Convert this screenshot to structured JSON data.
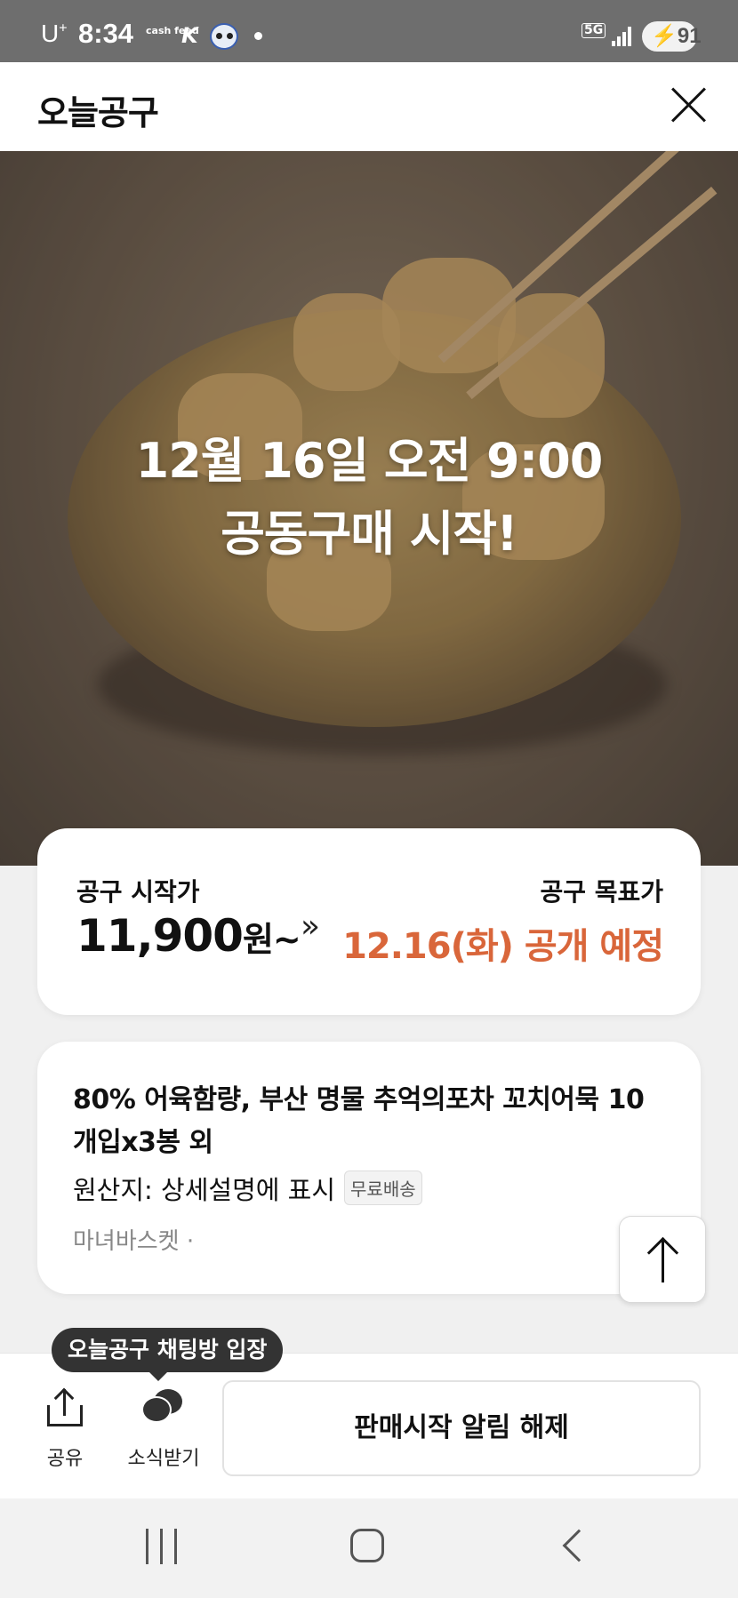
{
  "status_bar": {
    "carrier": "U",
    "carrier_plus": "+",
    "time": "8:34",
    "cashfeed_label": "cash feed",
    "network": "5G",
    "battery": "91"
  },
  "header": {
    "title": "오늘공구",
    "close_icon": "close-icon"
  },
  "hero": {
    "line1": "12월 16일 오전 9:00",
    "line2": "공동구매 시작!"
  },
  "price": {
    "start_label": "공구 시작가",
    "start_value": "11,900",
    "start_unit": "원~",
    "target_label": "공구 목표가",
    "target_value": "12.16(화) 공개 예정",
    "accent_color": "#d9663a"
  },
  "product": {
    "title": "80% 어육함량, 부산 명물 추억의포차 꼬치어묵 10개입x3봉 외",
    "origin": "원산지: 상세설명에 표시",
    "badge": "무료배송",
    "seller": "마녀바스켓 ·"
  },
  "bottom": {
    "tooltip": "오늘공구 채팅방 입장",
    "share_label": "공유",
    "news_label": "소식받기",
    "notify_button": "판매시작 알림 해제"
  }
}
